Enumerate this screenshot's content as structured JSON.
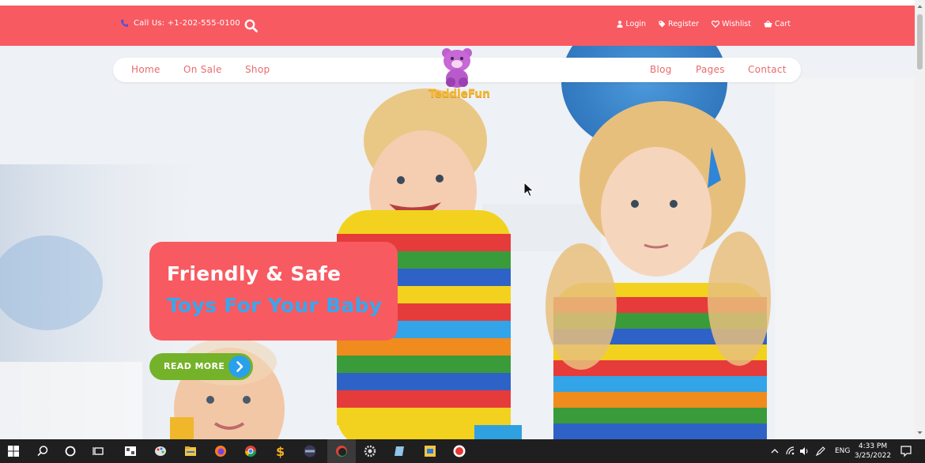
{
  "topbar": {
    "call_text": "Call Us: +1-202-555-0100",
    "links": [
      {
        "label": "Login",
        "icon": "user-icon"
      },
      {
        "label": "Register",
        "icon": "tag-icon"
      },
      {
        "label": "Wishlist",
        "icon": "heart-icon"
      },
      {
        "label": "Cart",
        "icon": "basket-icon"
      }
    ]
  },
  "nav": {
    "left": [
      "Home",
      "On Sale",
      "Shop"
    ],
    "right": [
      "Blog",
      "Pages",
      "Contact"
    ]
  },
  "logo": {
    "wordmark": "TeddleFun"
  },
  "promo": {
    "line1": "Friendly & Safe",
    "line2": "Toys For Your Baby",
    "button_label": "READ MORE"
  },
  "taskbar": {
    "language": "ENG",
    "time": "4:33 PM",
    "date": "3/25/2022"
  },
  "colors": {
    "brand_red": "#f85a62",
    "accent_blue": "#37a7ee",
    "button_green": "#74b22a",
    "nav_text": "#e96a6f"
  }
}
